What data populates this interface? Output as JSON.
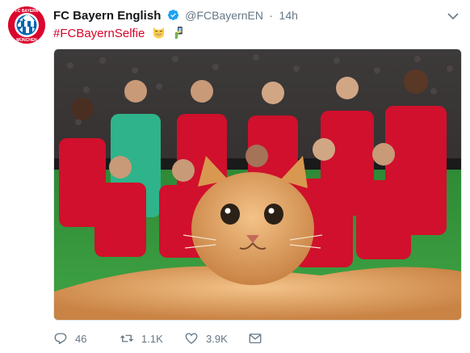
{
  "tweet": {
    "author_name": "FC Bayern English",
    "handle": "@FCBayernEN",
    "separator": "·",
    "time": "14h",
    "hashtag": "#FCBayernSelfie",
    "avatar_text_top": "FC BAYERN",
    "avatar_text_bottom": "MÜNCHEN"
  },
  "actions": {
    "reply_count": "46",
    "retweet_count": "1.1K",
    "like_count": "3.9K"
  },
  "icons": {
    "verified": "verified-badge-icon",
    "chevron": "chevron-down-icon",
    "emoji_1": "grinning-cat-emoji",
    "emoji_2": "selfie-emoji",
    "reply": "reply-icon",
    "retweet": "retweet-icon",
    "like": "heart-icon",
    "dm": "envelope-icon"
  },
  "colors": {
    "accent": "#dc052d",
    "hashtag": "#d6042a",
    "verified": "#1da1f2",
    "muted": "#657786",
    "text": "#14171a"
  }
}
